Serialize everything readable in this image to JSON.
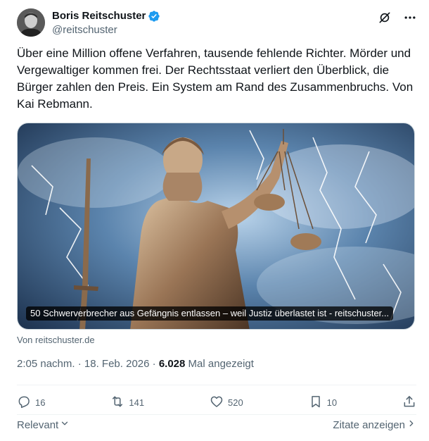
{
  "author": {
    "display_name": "Boris Reitschuster",
    "handle": "@reitschuster"
  },
  "tweet": {
    "text": "Über eine Million offene Verfahren, tausende fehlende Richter. Mörder und Vergewaltiger kommen frei. Der Rechtsstaat verliert den Überblick, die Bürger zahlen den Preis. Ein System am Rand des Zusammenbruchs. Von Kai Rebmann."
  },
  "media": {
    "caption": "50 Schwerverbrecher aus Gefängnis entlassen – weil Justiz überlastet ist - reitschuster...",
    "source": "Von reitschuster.de"
  },
  "meta": {
    "time": "2:05 nachm.",
    "separator": " · ",
    "date": "18. Feb. 2026",
    "views": "6.028",
    "views_label": " Mal angezeigt"
  },
  "stats": {
    "replies": "16",
    "reposts": "141",
    "likes": "520",
    "bookmarks": "10"
  },
  "footer": {
    "relevant": "Relevant",
    "quotes": "Zitate anzeigen"
  },
  "colors": {
    "verified": "#1d9bf0",
    "secondary": "#536471"
  },
  "icons": {
    "grok": "grok-icon",
    "more": "more-icon",
    "reply": "reply-icon",
    "repost": "repost-icon",
    "like": "like-icon",
    "bookmark": "bookmark-icon",
    "share": "share-icon"
  }
}
